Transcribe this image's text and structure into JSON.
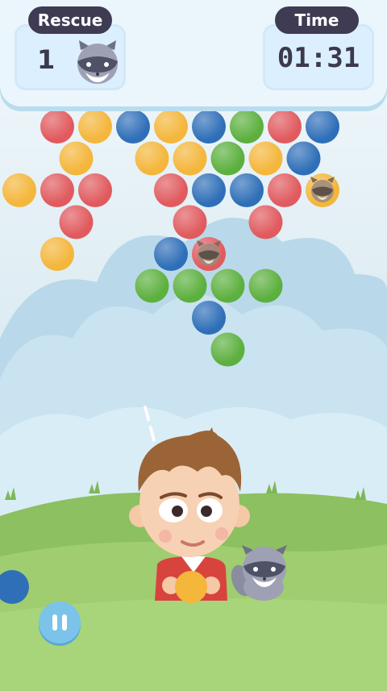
{
  "hud": {
    "rescue_label": "Rescue",
    "rescue_count": "1",
    "time_label": "Time",
    "time_value": "01:31"
  },
  "colors": {
    "red": "#e05a5e",
    "yellow": "#f4b63b",
    "blue": "#2f6fb8",
    "green": "#5cb03e"
  },
  "bubbles": [
    {
      "row": 0,
      "col": 1,
      "color": "red"
    },
    {
      "row": 0,
      "col": 2,
      "color": "yellow"
    },
    {
      "row": 0,
      "col": 3,
      "color": "blue"
    },
    {
      "row": 0,
      "col": 4,
      "color": "yellow"
    },
    {
      "row": 0,
      "col": 5,
      "color": "blue"
    },
    {
      "row": 0,
      "col": 6,
      "color": "green"
    },
    {
      "row": 0,
      "col": 7,
      "color": "red"
    },
    {
      "row": 0,
      "col": 8,
      "color": "blue"
    },
    {
      "row": 1,
      "col": 1,
      "color": "yellow"
    },
    {
      "row": 1,
      "col": 3,
      "color": "yellow"
    },
    {
      "row": 1,
      "col": 4,
      "color": "yellow"
    },
    {
      "row": 1,
      "col": 5,
      "color": "green"
    },
    {
      "row": 1,
      "col": 6,
      "color": "yellow"
    },
    {
      "row": 1,
      "col": 7,
      "color": "blue"
    },
    {
      "row": 2,
      "col": 0,
      "color": "yellow"
    },
    {
      "row": 2,
      "col": 1,
      "color": "red"
    },
    {
      "row": 2,
      "col": 2,
      "color": "red"
    },
    {
      "row": 2,
      "col": 4,
      "color": "red"
    },
    {
      "row": 2,
      "col": 5,
      "color": "blue"
    },
    {
      "row": 2,
      "col": 6,
      "color": "blue"
    },
    {
      "row": 2,
      "col": 7,
      "color": "red"
    },
    {
      "row": 2,
      "col": 8,
      "color": "yellow",
      "raccoon": true
    },
    {
      "row": 3,
      "col": 1,
      "color": "red"
    },
    {
      "row": 3,
      "col": 4,
      "color": "red"
    },
    {
      "row": 3,
      "col": 6,
      "color": "red"
    },
    {
      "row": 4,
      "col": 1,
      "color": "yellow"
    },
    {
      "row": 4,
      "col": 4,
      "color": "blue"
    },
    {
      "row": 4,
      "col": 5,
      "color": "red",
      "raccoon": true
    },
    {
      "row": 5,
      "col": 3,
      "color": "green"
    },
    {
      "row": 5,
      "col": 4,
      "color": "green"
    },
    {
      "row": 5,
      "col": 5,
      "color": "green"
    },
    {
      "row": 5,
      "col": 6,
      "color": "green"
    },
    {
      "row": 6,
      "col": 5,
      "color": "blue"
    },
    {
      "row": 7,
      "col": 5,
      "color": "green"
    }
  ],
  "shooter": {
    "current_color": "yellow",
    "next_color": "blue"
  },
  "controls": {
    "pause_icon": "pause-icon"
  }
}
